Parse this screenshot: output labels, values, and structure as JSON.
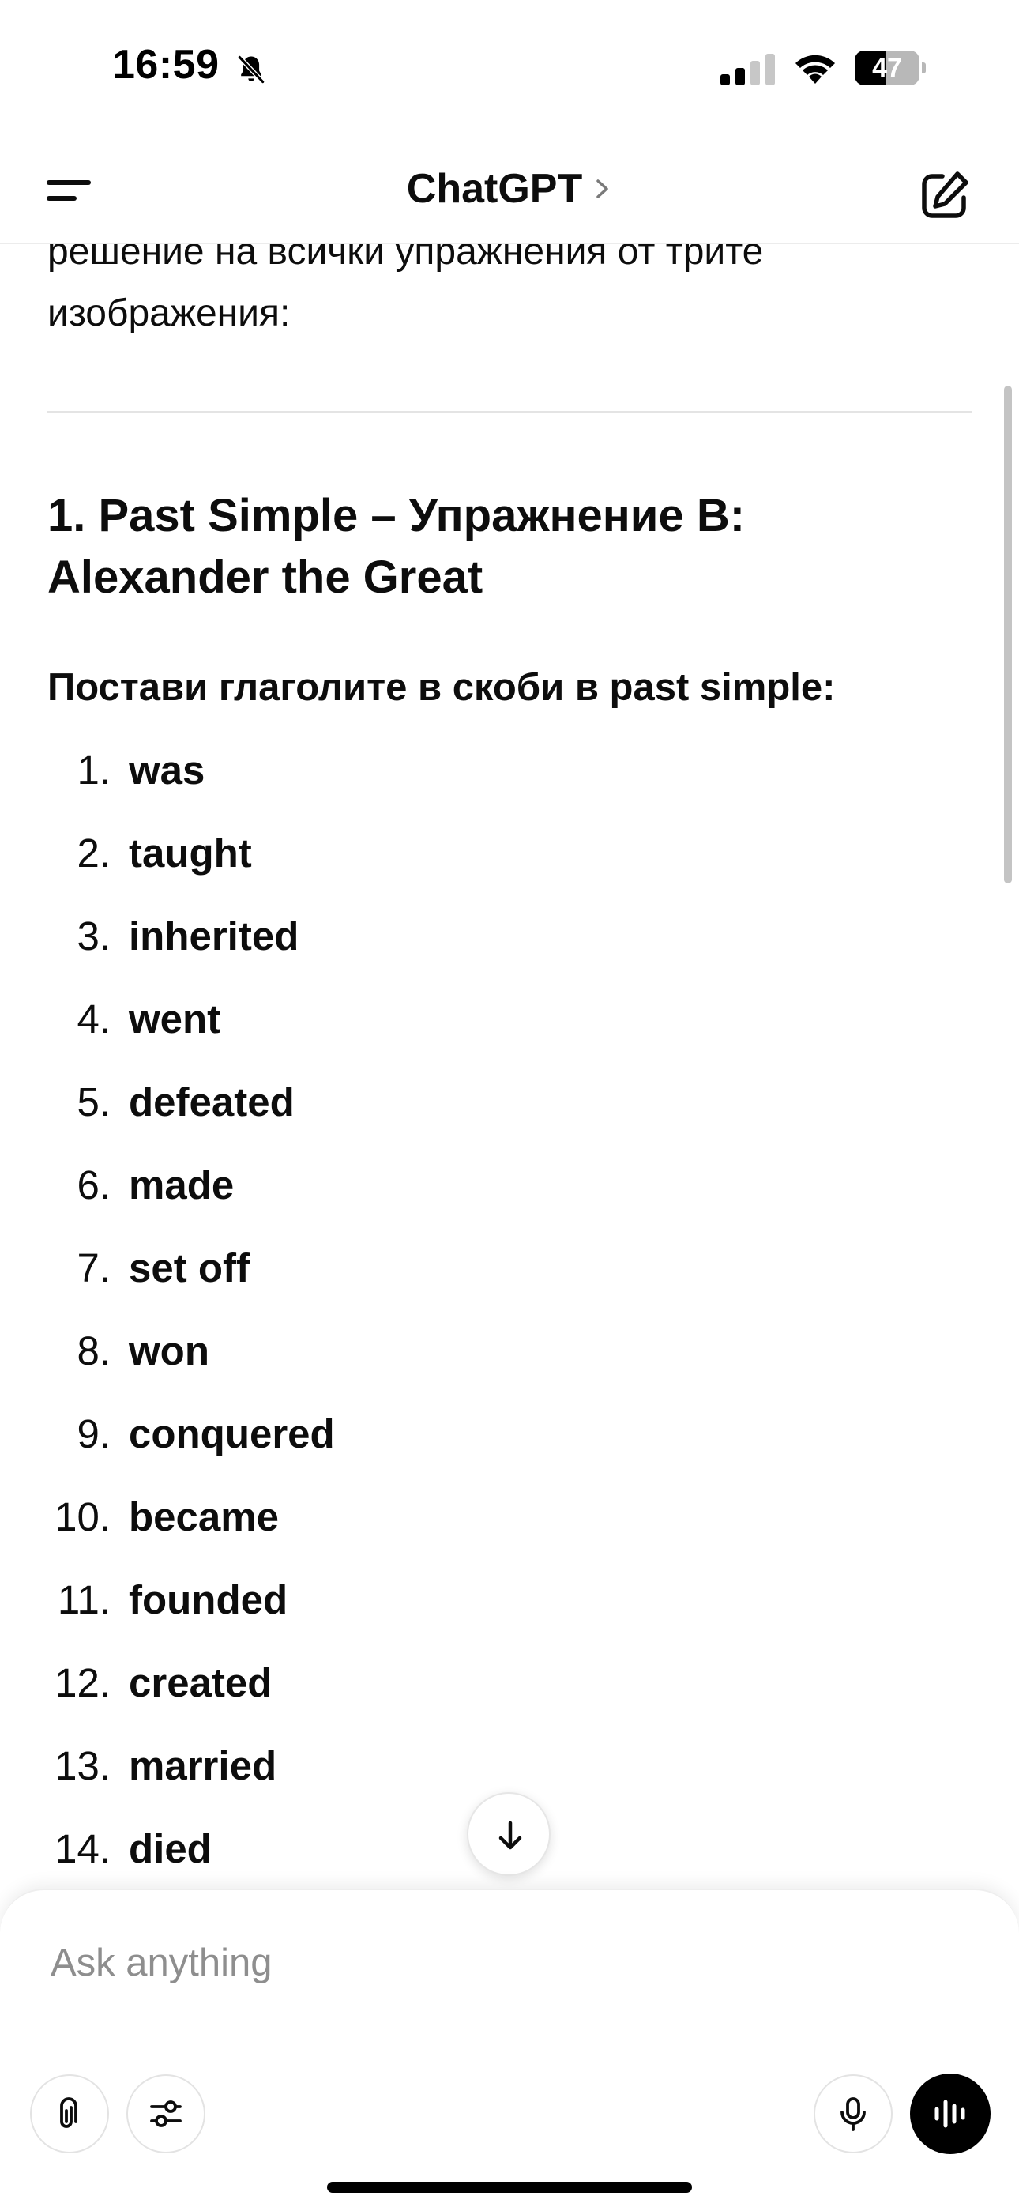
{
  "status_bar": {
    "time": "16:59",
    "battery_percent": "47",
    "battery_level": 0.47,
    "icons": [
      "bell-slash-icon",
      "cellular-signal-icon",
      "wifi-icon",
      "battery-icon"
    ]
  },
  "nav": {
    "title": "ChatGPT",
    "icons": [
      "menu-icon",
      "chevron-right-icon",
      "new-chat-icon"
    ]
  },
  "message": {
    "intro_line1": "решение на всички упражнения от трите",
    "intro_line2": "изображения:",
    "heading_line1": "1. Past Simple – Упражнение B:",
    "heading_line2": "Alexander the Great",
    "instruction": "Постави глаголите в скоби в past simple:",
    "answers": [
      {
        "num": "1.",
        "word": "was"
      },
      {
        "num": "2.",
        "word": "taught"
      },
      {
        "num": "3.",
        "word": "inherited"
      },
      {
        "num": "4.",
        "word": "went"
      },
      {
        "num": "5.",
        "word": "defeated"
      },
      {
        "num": "6.",
        "word": "made"
      },
      {
        "num": "7.",
        "word": "set off"
      },
      {
        "num": "8.",
        "word": "won"
      },
      {
        "num": "9.",
        "word": "conquered"
      },
      {
        "num": "10.",
        "word": "became"
      },
      {
        "num": "11.",
        "word": "founded"
      },
      {
        "num": "12.",
        "word": "created"
      },
      {
        "num": "13.",
        "word": "married"
      },
      {
        "num": "14.",
        "word": "died"
      }
    ]
  },
  "composer": {
    "placeholder": "Ask anything",
    "icons": [
      "paperclip-icon",
      "sliders-icon",
      "microphone-icon",
      "voice-mode-icon",
      "arrow-down-icon"
    ]
  }
}
